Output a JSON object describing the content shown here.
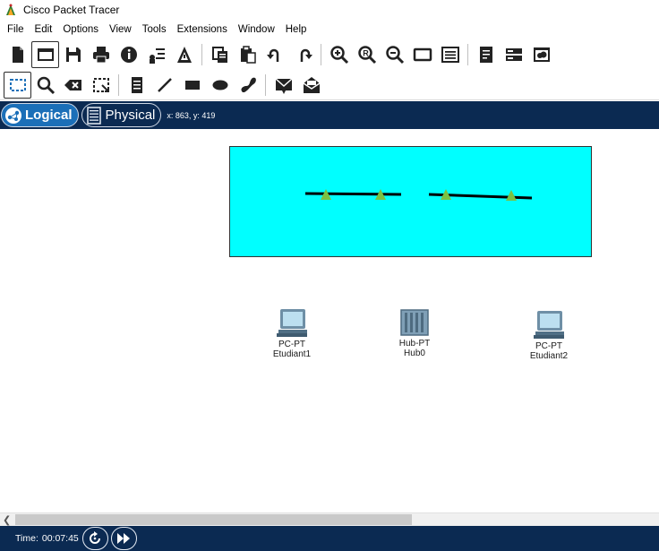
{
  "window": {
    "title": "Cisco Packet Tracer",
    "app_icon": "packet-tracer-icon"
  },
  "menu": [
    "File",
    "Edit",
    "Options",
    "View",
    "Tools",
    "Extensions",
    "Window",
    "Help"
  ],
  "toolbar_main": [
    "new-file-icon",
    "open-folder-icon",
    "save-icon",
    "print-icon",
    "info-icon",
    "network-wizard-icon",
    "activity-wizard-icon",
    "copy-icon",
    "paste-icon",
    "undo-icon",
    "redo-icon",
    "zoom-in-icon",
    "zoom-reset-icon",
    "zoom-out-icon",
    "drawing-palette-icon",
    "custom-devices-icon",
    "cluster-icon",
    "web-view-icon",
    "cloud-icon"
  ],
  "toolbar_tools": [
    "select-icon",
    "inspect-icon",
    "delete-icon",
    "resize-shape-icon",
    "note-icon",
    "draw-line-icon",
    "rectangle-icon",
    "ellipse-icon",
    "freeform-icon",
    "simple-pdu-icon",
    "complex-pdu-icon"
  ],
  "modes": {
    "logical": "Logical",
    "physical": "Physical"
  },
  "cursor_readout": "x: 863, y: 419",
  "topology": {
    "devices": [
      {
        "id": "pc1",
        "model": "PC-PT",
        "name": "Etudiant1"
      },
      {
        "id": "hub0",
        "model": "Hub-PT",
        "name": "Hub0"
      },
      {
        "id": "pc2",
        "model": "PC-PT",
        "name": "Etudiant2"
      }
    ],
    "links": [
      {
        "from": "Etudiant1",
        "to": "Hub0",
        "status": "up"
      },
      {
        "from": "Hub0",
        "to": "Etudiant2",
        "status": "up"
      }
    ],
    "cluster_color": "#00ffff",
    "link_up_color": "#7ac143"
  },
  "status": {
    "time_label": "Time:",
    "time_value": "00:07:45"
  },
  "colors": {
    "navy_bar": "#0b2a52",
    "logical_tab": "#1b6fb8"
  }
}
